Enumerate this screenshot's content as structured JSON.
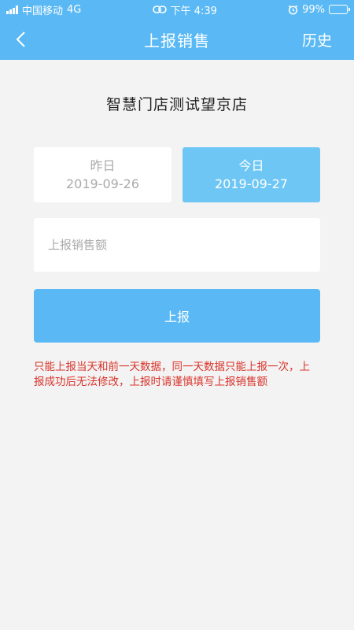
{
  "status_bar": {
    "carrier": "中国移动",
    "network": "4G",
    "time": "下午 4:39",
    "battery": "99%"
  },
  "nav": {
    "back_icon": "chevron-left-icon",
    "title": "上报销售",
    "history_label": "历史"
  },
  "store": {
    "name": "智慧门店测试望京店"
  },
  "dates": [
    {
      "label": "昨日",
      "date": "2019-09-26",
      "selected": false
    },
    {
      "label": "今日",
      "date": "2019-09-27",
      "selected": true
    }
  ],
  "form": {
    "amount_placeholder": "上报销售额",
    "amount_value": "",
    "submit_label": "上报"
  },
  "notice": "只能上报当天和前一天数据，同一天数据只能上报一次，上报成功后无法修改，上报时请谨慎填写上报销售额",
  "colors": {
    "primary": "#5ab9f4",
    "selected_card": "#6ec6f5",
    "warning_text": "#d9342b",
    "background": "#f3f3f3"
  }
}
